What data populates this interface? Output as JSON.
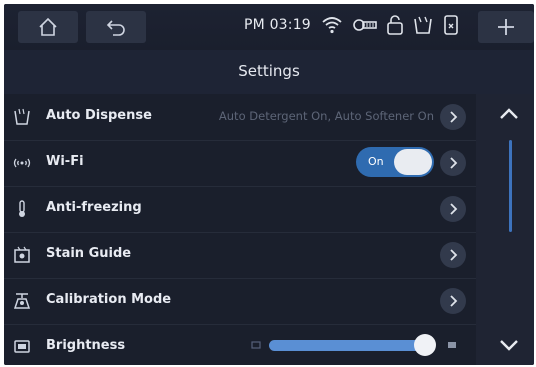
{
  "status_bar": {
    "time": "PM 03:19",
    "icons": [
      "home-icon",
      "back-icon",
      "wifi-icon",
      "key-icon",
      "lock-icon",
      "detergent-icon",
      "phone-icon",
      "plus-icon"
    ]
  },
  "header": {
    "title": "Settings"
  },
  "settings": [
    {
      "label": "Auto Dispense",
      "value": "Auto Detergent On, Auto Softener On",
      "icon": "auto-dispense-icon"
    },
    {
      "label": "Wi-Fi",
      "toggle": "On",
      "icon": "wifi-signal-icon"
    },
    {
      "label": "Anti-freezing",
      "icon": "thermometer-icon"
    },
    {
      "label": "Stain Guide",
      "icon": "stain-guide-icon"
    },
    {
      "label": "Calibration Mode",
      "icon": "scale-icon"
    },
    {
      "label": "Brightness",
      "icon": "brightness-icon",
      "level": 0.95
    }
  ],
  "colors": {
    "accent": "#3d73bd",
    "background": "#1c2130"
  }
}
